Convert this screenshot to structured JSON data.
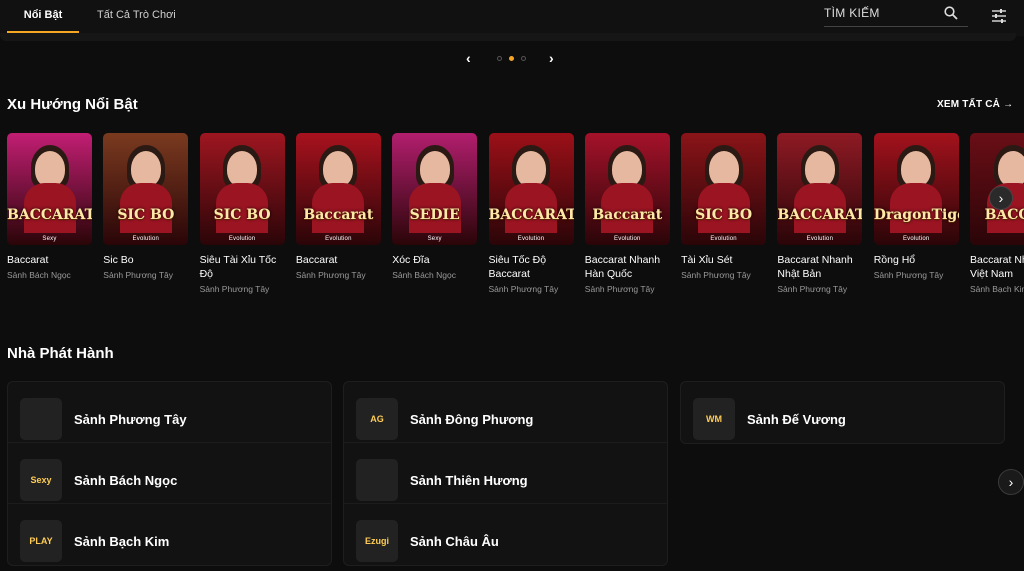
{
  "tabs": [
    {
      "label": "Nổi Bật",
      "active": true
    },
    {
      "label": "Tất Cả Trò Chơi",
      "active": false
    }
  ],
  "search": {
    "placeholder": "TÌM KIẾM"
  },
  "icons": {
    "search": "search-icon",
    "filter": "filter-sliders-icon"
  },
  "accent_color": "#f5a623",
  "pager": {
    "total": 3,
    "active": 2
  },
  "trending": {
    "title": "Xu Hướng Nổi Bật",
    "see_all": "XEM TẤT CẢ",
    "cards": [
      {
        "title": "Baccarat",
        "sub": "Sảnh Bách Ngọc",
        "logo": "BACCARAT",
        "brand": "Sexy",
        "bg": "#c21e73"
      },
      {
        "title": "Sic Bo",
        "sub": "Sảnh Phương Tây",
        "logo": "SIC BO",
        "brand": "Evolution",
        "bg": "#7a3a1f"
      },
      {
        "title": "Siêu Tài Xỉu Tốc Độ",
        "sub": "Sảnh Phương Tây",
        "logo": "SIC BO",
        "brand": "Evolution",
        "bg": "#9e1620"
      },
      {
        "title": "Baccarat",
        "sub": "Sảnh Phương Tây",
        "logo": "Baccarat",
        "brand": "Evolution",
        "bg": "#a8121e"
      },
      {
        "title": "Xóc Đĩa",
        "sub": "Sảnh Bách Ngọc",
        "logo": "SEDIE",
        "brand": "Sexy",
        "bg": "#b21e6e"
      },
      {
        "title": "Siêu Tốc Độ Baccarat",
        "sub": "Sảnh Phương Tây",
        "logo": "BACCARAT",
        "brand": "Evolution",
        "bg": "#9c1018"
      },
      {
        "title": "Baccarat Nhanh Hàn Quốc",
        "sub": "Sảnh Phương Tây",
        "logo": "Baccarat",
        "brand": "Evolution",
        "bg": "#a5122a"
      },
      {
        "title": "Tài Xỉu Sét",
        "sub": "Sảnh Phương Tây",
        "logo": "SIC BO",
        "brand": "Evolution",
        "bg": "#8a1418"
      },
      {
        "title": "Baccarat Nhanh Nhật Bản",
        "sub": "Sảnh Phương Tây",
        "logo": "BACCARAT",
        "brand": "Evolution",
        "bg": "#8e1a24"
      },
      {
        "title": "Rồng Hổ",
        "sub": "Sảnh Phương Tây",
        "logo": "DragonTiger",
        "brand": "Evolution",
        "bg": "#a3121c"
      },
      {
        "title": "Baccarat Nhanh Việt Nam",
        "sub": "Sảnh Bạch Kim",
        "logo": "BACCA",
        "brand": "",
        "bg": "#6a0e16"
      }
    ]
  },
  "providers": {
    "title": "Nhà Phát Hành",
    "columns": [
      [
        {
          "name": "Sảnh Phương Tây",
          "mark": ""
        },
        {
          "name": "Sảnh Bách Ngọc",
          "mark": "Sexy"
        },
        {
          "name": "Sảnh Bạch Kim",
          "mark": "PLAY"
        }
      ],
      [
        {
          "name": "Sảnh Đông Phương",
          "mark": "AG"
        },
        {
          "name": "Sảnh Thiên Hương",
          "mark": ""
        },
        {
          "name": "Sảnh Châu Âu",
          "mark": "Ezugi"
        }
      ],
      [
        {
          "name": "Sảnh Đế Vương",
          "mark": "WM"
        }
      ]
    ]
  }
}
